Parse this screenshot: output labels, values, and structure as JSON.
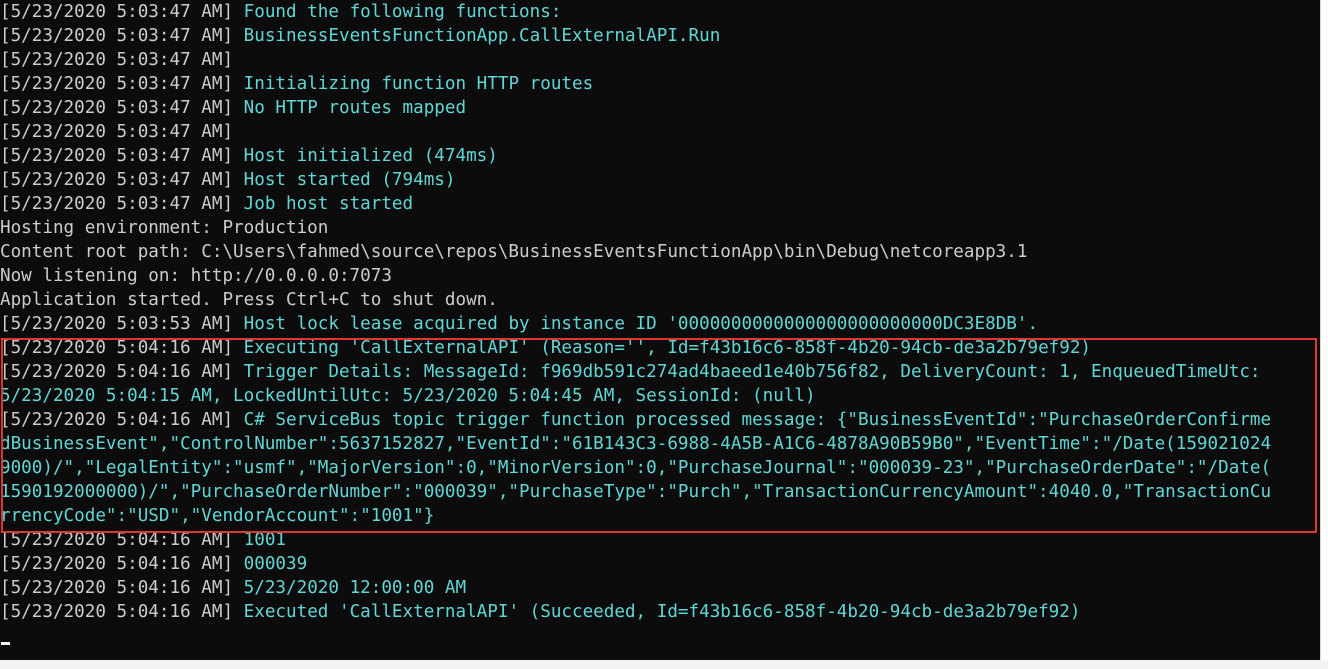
{
  "console": {
    "lines": [
      {
        "ts": "[5/23/2020 5:03:47 AM]",
        "msg": " Found the following functions:"
      },
      {
        "ts": "[5/23/2020 5:03:47 AM]",
        "msg": " BusinessEventsFunctionApp.CallExternalAPI.Run"
      },
      {
        "ts": "[5/23/2020 5:03:47 AM]",
        "msg": ""
      },
      {
        "ts": "[5/23/2020 5:03:47 AM]",
        "msg": " Initializing function HTTP routes"
      },
      {
        "ts": "[5/23/2020 5:03:47 AM]",
        "msg": " No HTTP routes mapped"
      },
      {
        "ts": "[5/23/2020 5:03:47 AM]",
        "msg": ""
      },
      {
        "ts": "[5/23/2020 5:03:47 AM]",
        "msg": " Host initialized (474ms)"
      },
      {
        "ts": "[5/23/2020 5:03:47 AM]",
        "msg": " Host started (794ms)"
      },
      {
        "ts": "[5/23/2020 5:03:47 AM]",
        "msg": " Job host started"
      },
      {
        "ts": "",
        "msg": "",
        "plain": "Hosting environment: Production"
      },
      {
        "ts": "",
        "msg": "",
        "plain": "Content root path: C:\\Users\\fahmed\\source\\repos\\BusinessEventsFunctionApp\\bin\\Debug\\netcoreapp3.1"
      },
      {
        "ts": "",
        "msg": "",
        "plain": "Now listening on: http://0.0.0.0:7073"
      },
      {
        "ts": "",
        "msg": "",
        "plain": "Application started. Press Ctrl+C to shut down."
      },
      {
        "ts": "[5/23/2020 5:03:53 AM]",
        "msg": " Host lock lease acquired by instance ID '0000000000000000000000000DC3E8DB'."
      },
      {
        "ts": "[5/23/2020 5:04:16 AM]",
        "msg": " Executing 'CallExternalAPI' (Reason='', Id=f43b16c6-858f-4b20-94cb-de3a2b79ef92)"
      },
      {
        "ts": "[5/23/2020 5:04:16 AM]",
        "msg": " Trigger Details: MessageId: f969db591c274ad4baeed1e40b756f82, DeliveryCount: 1, EnqueuedTimeUtc:"
      },
      {
        "ts": "",
        "msg": "5/23/2020 5:04:15 AM, LockedUntilUtc: 5/23/2020 5:04:45 AM, SessionId: (null)"
      },
      {
        "ts": "[5/23/2020 5:04:16 AM]",
        "msg": " C# ServiceBus topic trigger function processed message: {\"BusinessEventId\":\"PurchaseOrderConfirme"
      },
      {
        "ts": "",
        "msg": "dBusinessEvent\",\"ControlNumber\":5637152827,\"EventId\":\"61B143C3-6988-4A5B-A1C6-4878A90B59B0\",\"EventTime\":\"/Date(159021024"
      },
      {
        "ts": "",
        "msg": "9000)/\",\"LegalEntity\":\"usmf\",\"MajorVersion\":0,\"MinorVersion\":0,\"PurchaseJournal\":\"000039-23\",\"PurchaseOrderDate\":\"/Date("
      },
      {
        "ts": "",
        "msg": "1590192000000)/\",\"PurchaseOrderNumber\":\"000039\",\"PurchaseType\":\"Purch\",\"TransactionCurrencyAmount\":4040.0,\"TransactionCu"
      },
      {
        "ts": "",
        "msg": "rrencyCode\":\"USD\",\"VendorAccount\":\"1001\"}"
      },
      {
        "ts": "[5/23/2020 5:04:16 AM]",
        "msg": " 1001"
      },
      {
        "ts": "[5/23/2020 5:04:16 AM]",
        "msg": " 000039"
      },
      {
        "ts": "[5/23/2020 5:04:16 AM]",
        "msg": " 5/23/2020 12:00:00 AM"
      },
      {
        "ts": "[5/23/2020 5:04:16 AM]",
        "msg": " Executed 'CallExternalAPI' (Succeeded, Id=f43b16c6-858f-4b20-94cb-de3a2b79ef92)"
      }
    ]
  },
  "colors": {
    "background": "#0c0c0c",
    "timestamp": "#cccccc",
    "message": "#61d6d6",
    "highlight_border": "#e03535"
  }
}
